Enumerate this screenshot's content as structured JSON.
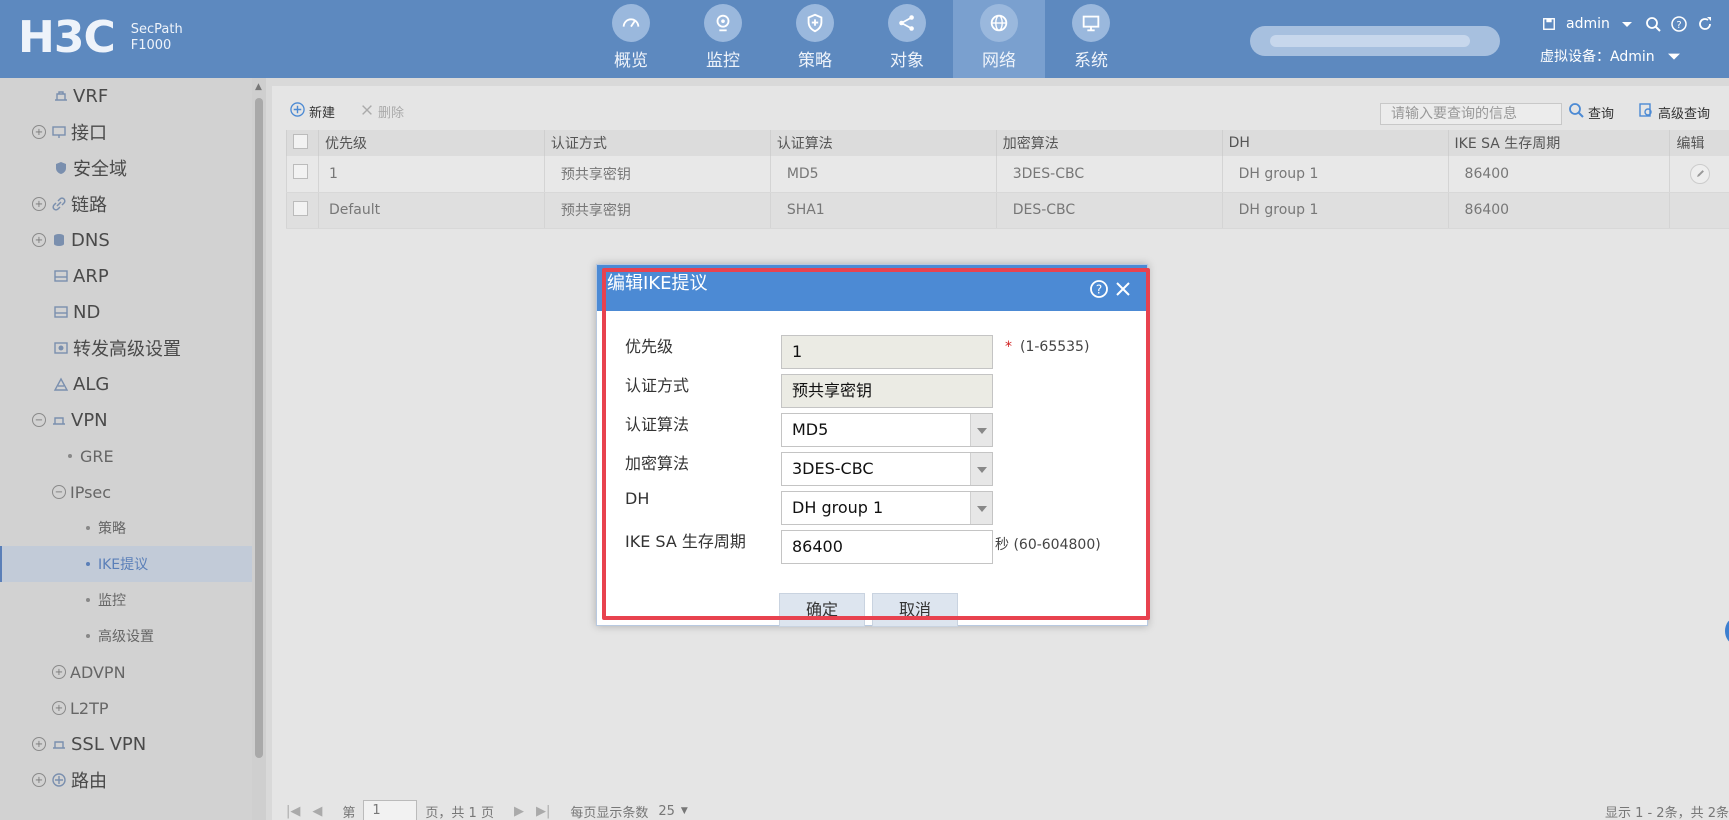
{
  "header": {
    "brand": "H3C",
    "product_line1": "SecPath",
    "product_line2": "F1000",
    "nav": [
      {
        "label": "概览",
        "icon": "gauge-icon"
      },
      {
        "label": "监控",
        "icon": "camera-icon"
      },
      {
        "label": "策略",
        "icon": "shield-icon"
      },
      {
        "label": "对象",
        "icon": "share-icon"
      },
      {
        "label": "网络",
        "icon": "globe-icon",
        "active": true
      },
      {
        "label": "系统",
        "icon": "monitor-icon"
      }
    ],
    "user": "admin",
    "virtual_device": "虚拟设备：Admin"
  },
  "sidebar": {
    "items": [
      {
        "label": "VRF",
        "level": 1
      },
      {
        "label": "接口",
        "level": 0
      },
      {
        "label": "安全域",
        "level": 1
      },
      {
        "label": "链路",
        "level": 0
      },
      {
        "label": "DNS",
        "level": 0
      },
      {
        "label": "ARP",
        "level": 1
      },
      {
        "label": "ND",
        "level": 1
      },
      {
        "label": "转发高级设置",
        "level": 1
      },
      {
        "label": "ALG",
        "level": 1
      },
      {
        "label": "VPN",
        "level": 0
      },
      {
        "label": "GRE",
        "level": 2
      },
      {
        "label": "IPsec",
        "level": 2
      },
      {
        "label": "策略",
        "level": 3
      },
      {
        "label": "IKE提议",
        "level": 3,
        "active": true
      },
      {
        "label": "监控",
        "level": 3
      },
      {
        "label": "高级设置",
        "level": 3
      },
      {
        "label": "ADVPN",
        "level": 2
      },
      {
        "label": "L2TP",
        "level": 2
      },
      {
        "label": "SSL VPN",
        "level": 0
      },
      {
        "label": "路由",
        "level": 0
      }
    ]
  },
  "toolbar": {
    "new_label": "新建",
    "delete_label": "删除",
    "search_placeholder": "请输入要查询的信息",
    "query_label": "查询",
    "advanced_query_label": "高级查询"
  },
  "table": {
    "columns": [
      "优先级",
      "认证方式",
      "认证算法",
      "加密算法",
      "DH",
      "IKE SA 生存周期",
      "编辑"
    ],
    "rows": [
      {
        "priority": "1",
        "auth_method": "预共享密钥",
        "auth_alg": "MD5",
        "enc_alg": "3DES-CBC",
        "dh": "DH group 1",
        "lifetime": "86400"
      },
      {
        "priority": "Default",
        "auth_method": "预共享密钥",
        "auth_alg": "SHA1",
        "enc_alg": "DES-CBC",
        "dh": "DH group 1",
        "lifetime": "86400"
      }
    ]
  },
  "pager": {
    "page_prefix": "第",
    "page_value": "1",
    "page_suffix": "页，共 1 页",
    "per_page_label": "每页显示条数",
    "per_page_value": "25",
    "summary": "显示 1 - 2条，共 2条"
  },
  "dialog": {
    "title": "编辑IKE提议",
    "fields": [
      {
        "label": "优先级",
        "value": "1",
        "hint": "(1-65535)",
        "required": true,
        "readonly": true
      },
      {
        "label": "认证方式",
        "value": "预共享密钥",
        "hint": "",
        "readonly": true
      },
      {
        "label": "认证算法",
        "value": "MD5",
        "hint": "",
        "select": true
      },
      {
        "label": "加密算法",
        "value": "3DES-CBC",
        "hint": "",
        "select": true
      },
      {
        "label": "DH",
        "value": "DH group 1",
        "hint": "",
        "select": true
      },
      {
        "label": "IKE SA 生存周期",
        "value": "86400",
        "hint": "秒   (60-604800)"
      }
    ],
    "ok_label": "确定",
    "cancel_label": "取消"
  },
  "colors": {
    "header_bg": "#5d89bf",
    "dialog_title_bg": "#4c8ad4",
    "highlight_frame": "#e8424f"
  }
}
